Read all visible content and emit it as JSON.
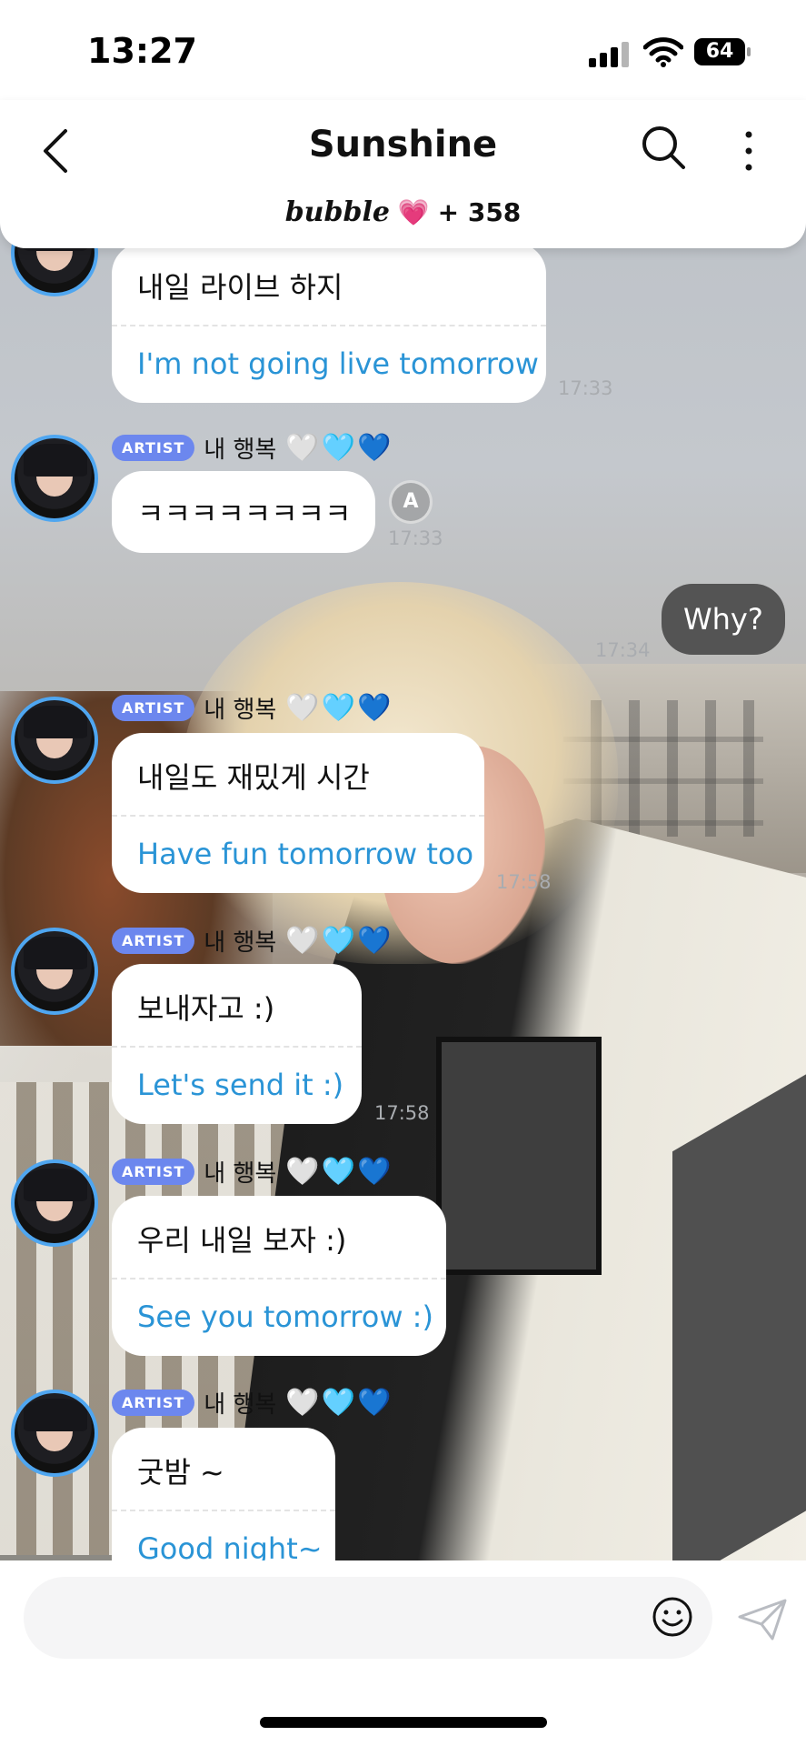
{
  "status_bar": {
    "time": "13:27",
    "battery": "64"
  },
  "header": {
    "title": "Sunshine",
    "brand": "bubble",
    "brand_heart": "💗",
    "count": "+ 358"
  },
  "messages": [
    {
      "type": "artist",
      "ko": "내일 라이브 하지",
      "en": "I'm not going live tomorrow",
      "time": "17:33"
    },
    {
      "type": "artist",
      "badge": "ARTIST",
      "name": "내 행복",
      "hearts": "🤍🩵💙",
      "ko": "ㅋㅋㅋㅋㅋㅋㅋㅋ",
      "time": "17:33",
      "translate_icon": "A"
    },
    {
      "type": "me",
      "text": "Why?",
      "time": "17:34"
    },
    {
      "type": "artist",
      "badge": "ARTIST",
      "name": "내 행복",
      "hearts": "🤍🩵💙",
      "ko": "내일도 재밌게 시간",
      "en": "Have fun tomorrow too",
      "time": "17:58"
    },
    {
      "type": "artist",
      "badge": "ARTIST",
      "name": "내 행복",
      "hearts": "🤍🩵💙",
      "ko": "보내자고 :)",
      "en": "Let's send it :)",
      "time": "17:58"
    },
    {
      "type": "artist",
      "badge": "ARTIST",
      "name": "내 행복",
      "hearts": "🤍🩵💙",
      "ko": "우리 내일 보자 :)",
      "en": "See you tomorrow :)"
    },
    {
      "type": "artist",
      "badge": "ARTIST",
      "name": "내 행복",
      "hearts": "🤍🩵💙",
      "ko": "굿밤 ~",
      "en": "Good night~"
    }
  ],
  "composer": {
    "placeholder": ""
  },
  "icons": {
    "back": "chevron-left-icon",
    "search": "search-icon",
    "more": "more-vertical-icon",
    "emoji": "smiley-icon",
    "send": "send-icon"
  },
  "colors": {
    "translation_text": "#2a94d6",
    "artist_badge": "#6c87ee",
    "avatar_ring": "#4fa6f0",
    "my_bubble": "#545454"
  }
}
